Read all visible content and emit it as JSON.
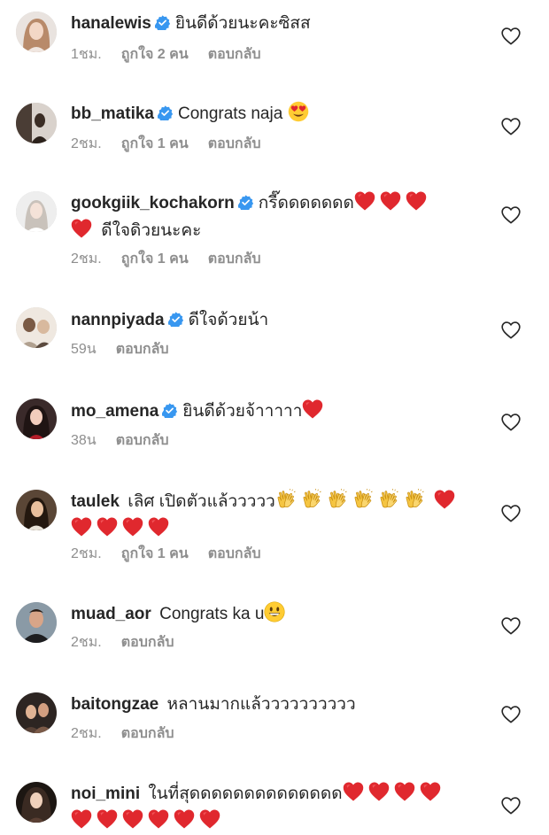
{
  "colors": {
    "text": "#262626",
    "meta": "#8e8e8e",
    "verified": "#3897f0",
    "red_heart": "#e0282e",
    "clap": "#f5c542"
  },
  "comments": [
    {
      "username": "hanalewis",
      "verified": true,
      "text": "ยินดีด้วยนะคะซิสส",
      "time": "1ชม.",
      "likes": "ถูกใจ 2 คน",
      "reply": "ตอบกลับ",
      "avatar_icon": "woman-avatar"
    },
    {
      "username": "bb_matika",
      "verified": true,
      "text": "Congrats naja",
      "emoji": "heart-eyes-emoji",
      "time": "2ชม.",
      "likes": "ถูกใจ 1 คน",
      "reply": "ตอบกลับ"
    },
    {
      "username": "gookgiik_kochakorn",
      "verified": true,
      "text": "กรี๊ดดดดดดด",
      "text2": "ดีใจดิวยนะคะ",
      "emoji": "red-heart-emoji",
      "time": "2ชม.",
      "likes": "ถูกใจ 1 คน",
      "reply": "ตอบกลับ"
    },
    {
      "username": "nannpiyada",
      "verified": true,
      "text": "ดีใจด้วยน้า",
      "time": "59น",
      "reply": "ตอบกลับ"
    },
    {
      "username": "mo_amena",
      "verified": true,
      "text": "ยินดีด้วยจ้าาาาา",
      "emoji": "red-heart-emoji",
      "time": "38น",
      "reply": "ตอบกลับ"
    },
    {
      "username": "taulek",
      "verified": false,
      "text": "เลิศ เปิดตัวแล้ววววว",
      "emoji": "clapping-hands-emoji",
      "time": "2ชม.",
      "likes": "ถูกใจ 1 คน",
      "reply": "ตอบกลับ"
    },
    {
      "username": "muad_aor",
      "verified": false,
      "text": "Congrats ka u",
      "emoji": "smiley-emoji",
      "time": "2ชม.",
      "reply": "ตอบกลับ"
    },
    {
      "username": "baitongzae",
      "verified": false,
      "text": "หลานมากแล้วววววววววว",
      "time": "2ชม.",
      "reply": "ตอบกลับ"
    },
    {
      "username": "noi_mini",
      "verified": false,
      "text": "ในที่สุดดดดดดดดดดดดดด",
      "emoji": "red-heart-emoji"
    }
  ]
}
